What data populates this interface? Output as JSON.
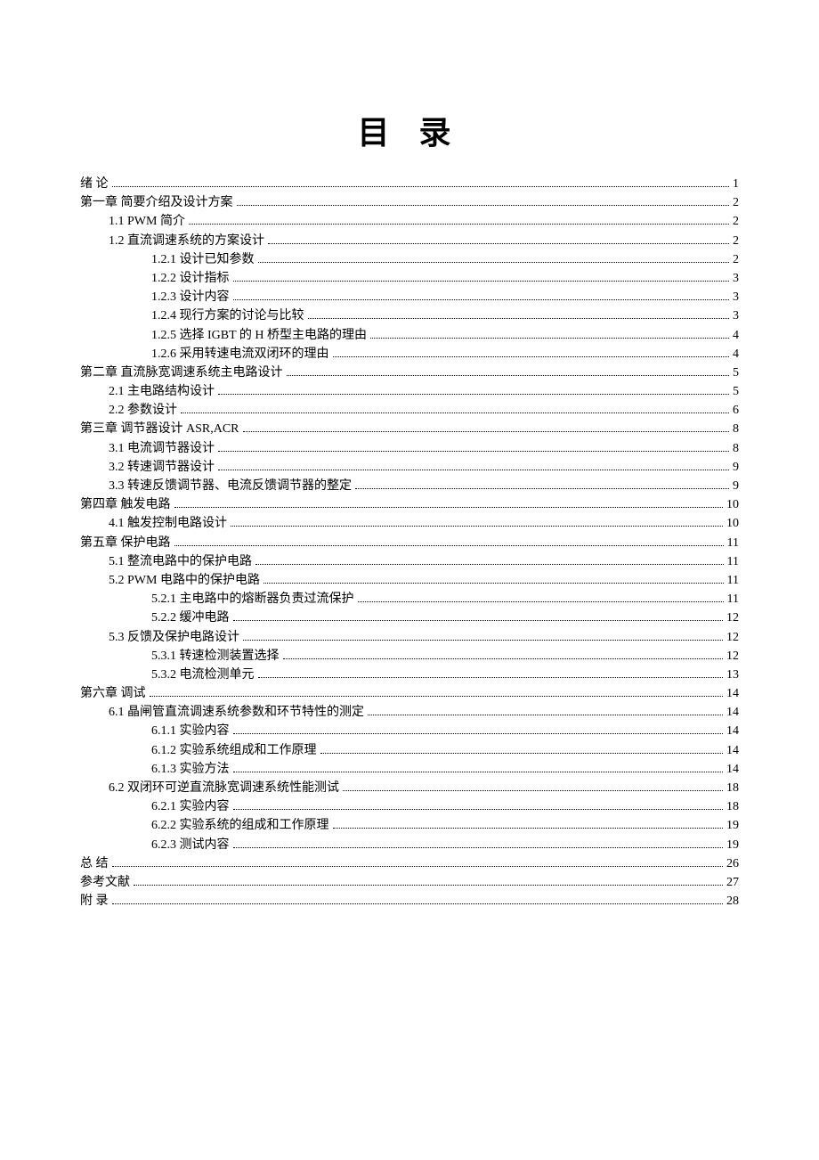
{
  "title": "目 录",
  "entries": [
    {
      "level": 0,
      "label": "绪 论",
      "page": "1"
    },
    {
      "level": 0,
      "label": "第一章 简要介绍及设计方案",
      "page": "2"
    },
    {
      "level": 1,
      "label": "1.1 PWM 简介",
      "page": "2"
    },
    {
      "level": 1,
      "label": "1.2  直流调速系统的方案设计",
      "page": "2"
    },
    {
      "level": 2,
      "label": "1.2.1    设计已知参数",
      "page": "2"
    },
    {
      "level": 2,
      "label": "1.2.2    设计指标",
      "page": "3"
    },
    {
      "level": 2,
      "label": "1.2.3 设计内容",
      "page": "3"
    },
    {
      "level": 2,
      "label": "1.2.4 现行方案的讨论与比较",
      "page": "3"
    },
    {
      "level": 2,
      "label": "1.2.5 选择 IGBT 的 H 桥型主电路的理由",
      "page": "4"
    },
    {
      "level": 2,
      "label": "1.2.6 采用转速电流双闭环的理由",
      "page": "4"
    },
    {
      "level": 0,
      "label": "第二章 直流脉宽调速系统主电路设计",
      "page": "5"
    },
    {
      "level": 1,
      "label": "2.1    主电路结构设计",
      "page": "5"
    },
    {
      "level": 1,
      "label": "2.2 参数设计",
      "page": "6"
    },
    {
      "level": 0,
      "label": "第三章 调节器设计 ASR,ACR",
      "page": "8"
    },
    {
      "level": 1,
      "label": "3.1    电流调节器设计",
      "page": "8"
    },
    {
      "level": 1,
      "label": "3.2    转速调节器设计",
      "page": "9"
    },
    {
      "level": 1,
      "label": "3.3 转速反馈调节器、电流反馈调节器的整定",
      "page": "9"
    },
    {
      "level": 0,
      "label": "第四章 触发电路",
      "page": "10"
    },
    {
      "level": 1,
      "label": "4.1 触发控制电路设计",
      "page": "10"
    },
    {
      "level": 0,
      "label": "第五章 保护电路",
      "page": "11"
    },
    {
      "level": 1,
      "label": "5.1    整流电路中的保护电路",
      "page": "11"
    },
    {
      "level": 1,
      "label": "5.2 PWM 电路中的保护电路",
      "page": "11"
    },
    {
      "level": 2,
      "label": "5.2.1 主电路中的熔断器负责过流保护",
      "page": "11"
    },
    {
      "level": 2,
      "label": "5.2.2 缓冲电路",
      "page": "12"
    },
    {
      "level": 1,
      "label": "5.3 反馈及保护电路设计",
      "page": "12"
    },
    {
      "level": 2,
      "label": "5.3.1 转速检测装置选择",
      "page": "12"
    },
    {
      "level": 2,
      "label": "5.3.2 电流检测单元",
      "page": "13"
    },
    {
      "level": 0,
      "label": "第六章 调试",
      "page": "14"
    },
    {
      "level": 1,
      "label": "6.1 晶闸管直流调速系统参数和环节特性的测定",
      "page": "14"
    },
    {
      "level": 2,
      "label": "6.1.1 实验内容",
      "page": "14"
    },
    {
      "level": 2,
      "label": "6.1.2   实验系统组成和工作原理",
      "page": "14"
    },
    {
      "level": 2,
      "label": "6.1.3   实验方法",
      "page": "14"
    },
    {
      "level": 1,
      "label": "6.2    双闭环可逆直流脉宽调速系统性能测试",
      "page": "18"
    },
    {
      "level": 2,
      "label": "6.2.1    实验内容",
      "page": "18"
    },
    {
      "level": 2,
      "label": "6.2.2    实验系统的组成和工作原理",
      "page": "19"
    },
    {
      "level": 2,
      "label": "6.2.3    测试内容",
      "page": "19"
    },
    {
      "level": 0,
      "label": "总 结",
      "page": "26"
    },
    {
      "level": 0,
      "label": "参考文献",
      "page": "27"
    },
    {
      "level": 0,
      "label": "附 录",
      "page": "28"
    }
  ]
}
